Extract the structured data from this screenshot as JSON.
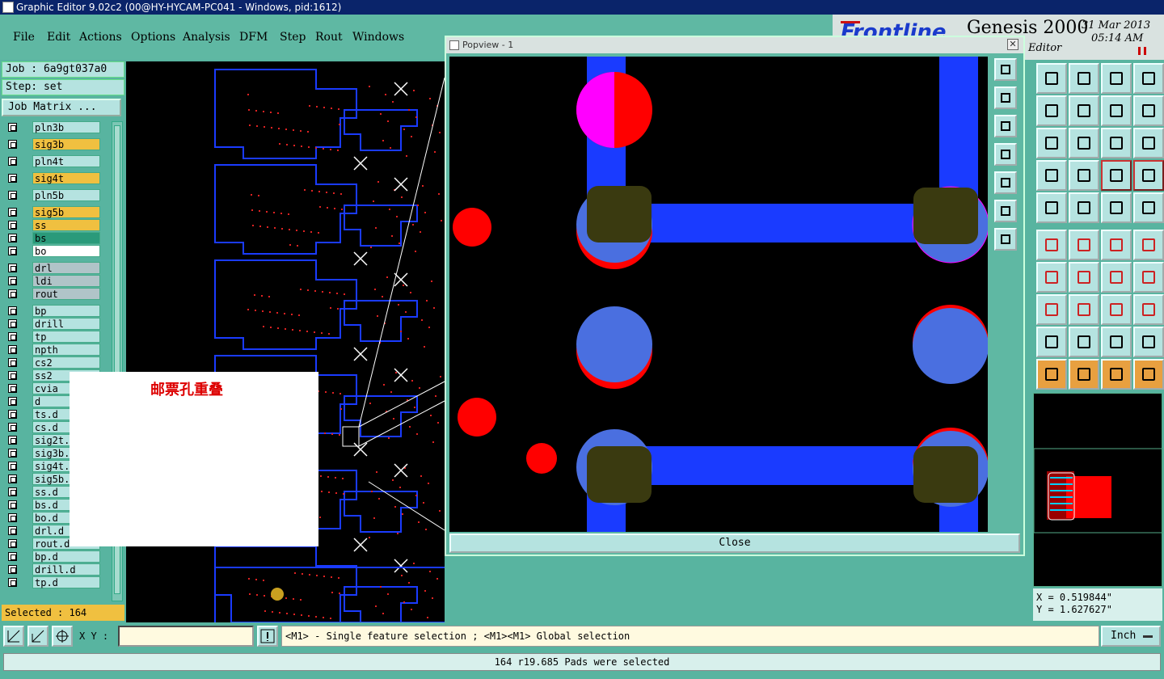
{
  "window": {
    "title": "Graphic Editor 9.02c2 (00@HY-HYCAM-PC041 - Windows, pid:1612)"
  },
  "menu": [
    "File",
    "Edit",
    "Actions",
    "Options",
    "Analysis",
    "DFM",
    "Step",
    "Rout",
    "Windows"
  ],
  "brand": {
    "product": "Genesis 2000",
    "subtitle": "Editor",
    "date": "31 Mar 2013",
    "time": "05:14 AM"
  },
  "job": {
    "job_label": "Job : 6a9gt037a0",
    "step_label": "Step: set",
    "matrix_button": "Job Matrix ..."
  },
  "layers": [
    {
      "name": "pln3b",
      "color": "#b5e3e0"
    },
    {
      "name": "sig3b",
      "color": "#f0c040"
    },
    {
      "name": "pln4t",
      "color": "#b5e3e0"
    },
    {
      "name": "sig4t",
      "color": "#f0c040"
    },
    {
      "name": "pln5b",
      "color": "#b5e3e0"
    },
    {
      "name": "sig5b",
      "color": "#f0c040"
    },
    {
      "name": "ss",
      "color": "#f0c040"
    },
    {
      "name": "bs",
      "color": "#2a9a7a"
    },
    {
      "name": "bo",
      "color": "#ffffff"
    },
    {
      "name": "drl",
      "color": "#b0c4c8"
    },
    {
      "name": "ldi",
      "color": "#b0c4c8"
    },
    {
      "name": "rout",
      "color": "#b0c4c8"
    },
    {
      "name": "bp",
      "color": "#b5e3e0"
    },
    {
      "name": "drill",
      "color": "#b5e3e0"
    },
    {
      "name": "tp",
      "color": "#b5e3e0"
    },
    {
      "name": "npth",
      "color": "#b5e3e0"
    },
    {
      "name": "cs2",
      "color": "#b5e3e0"
    },
    {
      "name": "ss2",
      "color": "#b5e3e0"
    },
    {
      "name": "cvia",
      "color": "#b5e3e0"
    },
    {
      "name": "d",
      "color": "#b5e3e0"
    },
    {
      "name": "ts.d",
      "color": "#b5e3e0"
    },
    {
      "name": "cs.d",
      "color": "#b5e3e0"
    },
    {
      "name": "sig2t.",
      "color": "#b5e3e0"
    },
    {
      "name": "sig3b.",
      "color": "#b5e3e0"
    },
    {
      "name": "sig4t.",
      "color": "#b5e3e0"
    },
    {
      "name": "sig5b.",
      "color": "#b5e3e0"
    },
    {
      "name": "ss.d",
      "color": "#b5e3e0"
    },
    {
      "name": "bs.d",
      "color": "#b5e3e0"
    },
    {
      "name": "bo.d",
      "color": "#b5e3e0"
    },
    {
      "name": "drl.d",
      "color": "#b5e3e0"
    },
    {
      "name": "rout.d",
      "color": "#b5e3e0"
    },
    {
      "name": "bp.d",
      "color": "#b5e3e0"
    },
    {
      "name": "drill.d",
      "color": "#b5e3e0"
    },
    {
      "name": "tp.d",
      "color": "#b5e3e0"
    }
  ],
  "selected_count": "Selected : 164",
  "overlay_note": "邮票孔重叠",
  "popview": {
    "title": "Popview - 1",
    "close_label": "Close"
  },
  "coords": {
    "x": "X = 0.519844\"",
    "y": "Y = 1.627627\""
  },
  "status": {
    "xy_label": "X Y :",
    "prompt": "<M1> - Single feature selection ; <M1><M1> Global selection",
    "unit": "Inch",
    "message": "164 r19.685 Pads were selected"
  },
  "colors": {
    "pad_blue": "#4a6fe0",
    "trace_blue": "#1a3bff",
    "drill_red": "#ff0000",
    "overlap_olive": "#3a3a10",
    "magenta": "#ff00ff"
  }
}
